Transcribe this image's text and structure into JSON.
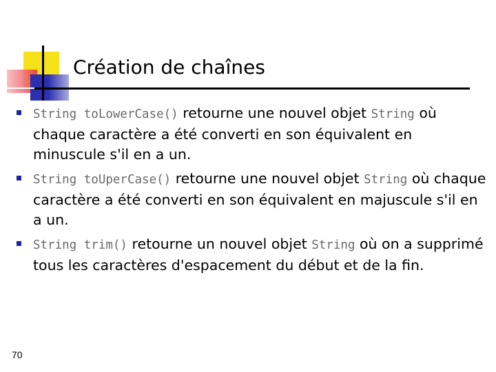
{
  "slide": {
    "title": "Création de chaînes",
    "page_number": "70"
  },
  "bullets": [
    {
      "code1": "String toLowerCase()",
      "text1": " retourne une nouvel objet ",
      "code2": "String",
      "text2": " où chaque caractère a été converti en son équivalent en minuscule s'il en a un."
    },
    {
      "code1": "String toUperCase()",
      "text1": " retourne une nouvel objet ",
      "code2": "String",
      "text2": " où chaque caractère a été converti en son équivalent en majuscule s'il en a un."
    },
    {
      "code1": "String trim()",
      "text1": " retourne un nouvel objet ",
      "code2": "String",
      "text2": " où on a supprimé tous les caractères d'espacement du début et de la fin."
    }
  ],
  "colors": {
    "bullet": "#1c24a0",
    "logo_yellow": "#f5e21b",
    "logo_red": "#e8303a",
    "logo_blue": "#2b2fb0",
    "code_text": "#6a6a6a"
  }
}
